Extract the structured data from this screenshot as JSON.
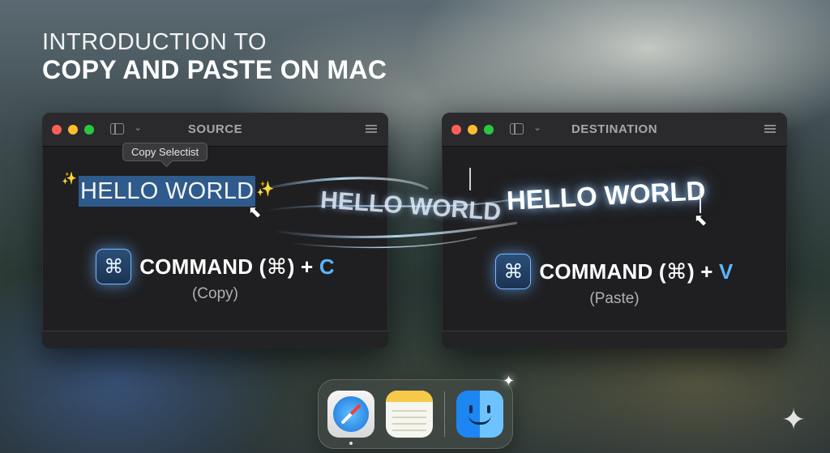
{
  "heading": {
    "line1": "INTRODUCTION TO",
    "line2": "COPY AND PASTE ON MAC"
  },
  "source_window": {
    "title": "SOURCE",
    "tooltip": "Copy Selectist",
    "selected_text": "HELLO WORLD",
    "command_label": "COMMAND (",
    "command_symbol": "⌘",
    "command_plus": ") + ",
    "command_key": "C",
    "action_label": "(Copy)"
  },
  "transfer": {
    "flying_text": "HELLO WORLD"
  },
  "destination_window": {
    "title": "DESTINATION",
    "pasted_text": "HELLO WORLD",
    "command_label": "COMMAND (",
    "command_symbol": "⌘",
    "command_plus": ") + ",
    "command_key": "V",
    "action_label": "(Paste)"
  },
  "icons": {
    "command_key": "⌘",
    "sparkle": "✨",
    "cursor": "⬉",
    "twinkle": "✦",
    "gem": "✦"
  },
  "colors": {
    "accent_blue": "#5cb4ff",
    "selection": "#2e5a8c",
    "traffic_red": "#ff5f57",
    "traffic_yellow": "#febc2e",
    "traffic_green": "#28c840"
  },
  "dock": {
    "apps": [
      "safari-icon",
      "notes-icon",
      "finder-icon"
    ]
  }
}
